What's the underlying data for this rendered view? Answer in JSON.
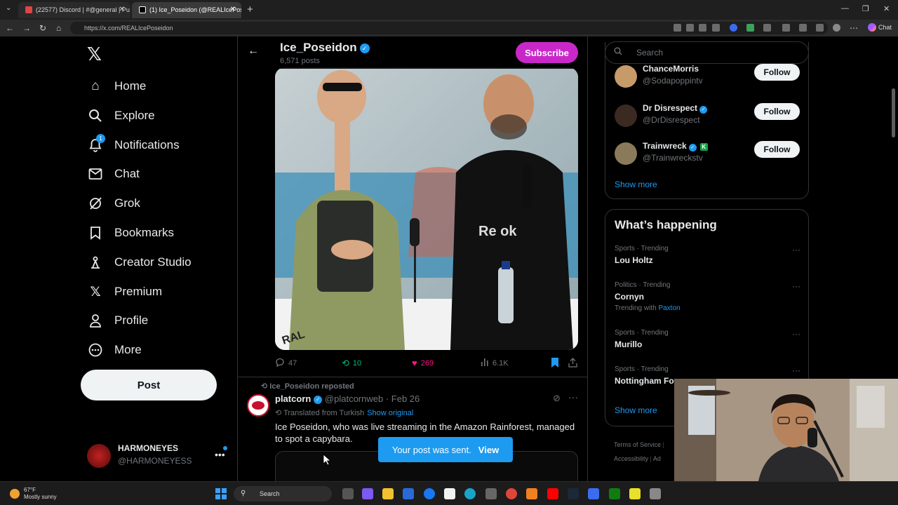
{
  "browser": {
    "tabs": [
      {
        "label": "(22577) Discord | #@general | Pu",
        "active": false,
        "color": "#e04444"
      },
      {
        "label": "(1) Ice_Poseidon (@REALIcePoseidon",
        "active": true,
        "color": "#ffffff"
      }
    ],
    "url": "https://x.com/REALIcePoseidon",
    "chat_label": "Chat"
  },
  "sidebar": {
    "items": [
      {
        "label": "Home",
        "icon": "home-icon"
      },
      {
        "label": "Explore",
        "icon": "search-icon"
      },
      {
        "label": "Notifications",
        "icon": "bell-icon",
        "badge": "1"
      },
      {
        "label": "Chat",
        "icon": "mail-icon"
      },
      {
        "label": "Grok",
        "icon": "grok-icon"
      },
      {
        "label": "Bookmarks",
        "icon": "bookmark-icon"
      },
      {
        "label": "Creator Studio",
        "icon": "creator-studio-icon"
      },
      {
        "label": "Premium",
        "icon": "x-premium-icon"
      },
      {
        "label": "Profile",
        "icon": "person-icon"
      },
      {
        "label": "More",
        "icon": "more-circle-icon"
      }
    ],
    "post_label": "Post",
    "account": {
      "name": "HARMONEYES",
      "handle": "@HARMONEYESS"
    }
  },
  "profile": {
    "name": "Ice_Poseidon",
    "posts": "6,571 posts",
    "subscribe_label": "Subscribe"
  },
  "tweet1": {
    "replies": "47",
    "reposts": "10",
    "likes": "269",
    "views": "6.1K"
  },
  "tweet2": {
    "repost_by": "Ice_Poseidon reposted",
    "name": "platcorn",
    "handle": "@platcornweb",
    "date": "· Feb 26",
    "translated": "Translated from Turkish",
    "show_original": "Show original",
    "text": "Ice Poseidon, who was live streaming in the Amazon Rainforest, managed to spot a capybara."
  },
  "toast": {
    "message": "Your post was sent.",
    "action": "View"
  },
  "right": {
    "search_placeholder": "Search",
    "follow_label": "Follow",
    "who_to_follow": [
      {
        "name": "ChanceMorris",
        "handle": "@Sodapoppintv",
        "verified": false
      },
      {
        "name": "Dr Disrespect",
        "handle": "@DrDisrespect",
        "verified": true
      },
      {
        "name": "Trainwreck",
        "handle": "@Trainwreckstv",
        "verified": true
      }
    ],
    "show_more": "Show more",
    "happening_title": "What’s happening",
    "trends": [
      {
        "category": "Sports · Trending",
        "name": "Lou Holtz"
      },
      {
        "category": "Politics · Trending",
        "name": "Cornyn",
        "with_label": "Trending with",
        "with_link": "Paxton"
      },
      {
        "category": "Sports · Trending",
        "name": "Murillo"
      },
      {
        "category": "Sports · Trending",
        "name": "Nottingham Fo"
      }
    ],
    "footer": {
      "terms": "Terms of Service",
      "accessibility": "Accessibility",
      "ad": "Ad"
    }
  },
  "taskbar": {
    "temp": "67°F",
    "weather": "Mostly sunny",
    "search": "Search"
  }
}
